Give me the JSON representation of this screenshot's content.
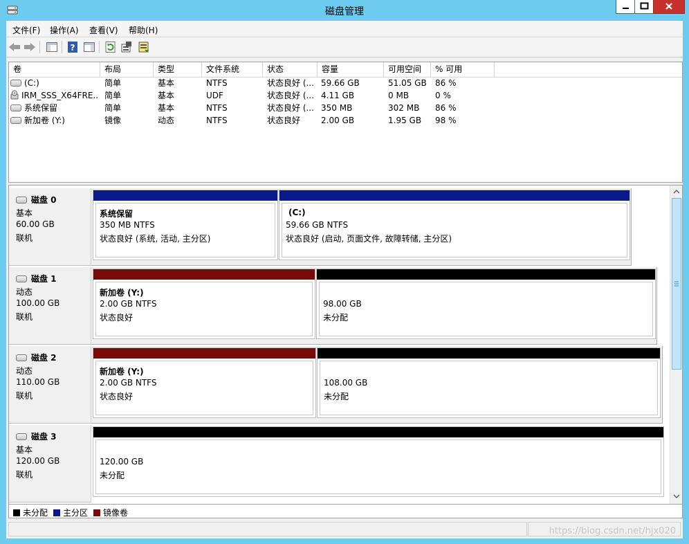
{
  "window": {
    "title": "磁盘管理"
  },
  "menubar": {
    "items": [
      "文件(F)",
      "操作(A)",
      "查看(V)",
      "帮助(H)"
    ]
  },
  "toolbar": {
    "buttons": [
      "back-icon",
      "forward-icon",
      "show-hide-tree-icon",
      "help-icon",
      "console-view-icon",
      "refresh-icon",
      "properties-icon",
      "export-icon"
    ]
  },
  "volume_list": {
    "columns": [
      "卷",
      "布局",
      "类型",
      "文件系统",
      "状态",
      "容量",
      "可用空间",
      "% 可用"
    ],
    "rows": [
      {
        "icon": "drive-icon",
        "volume": "(C:)",
        "layout": "简单",
        "type": "基本",
        "fs": "NTFS",
        "status": "状态良好 (...",
        "capacity": "59.66 GB",
        "free": "51.05 GB",
        "pct": "86 %"
      },
      {
        "icon": "cd-icon",
        "volume": "IRM_SSS_X64FRE...",
        "layout": "简单",
        "type": "基本",
        "fs": "UDF",
        "status": "状态良好 (...",
        "capacity": "4.11 GB",
        "free": "0 MB",
        "pct": "0 %"
      },
      {
        "icon": "drive-icon",
        "volume": "系统保留",
        "layout": "简单",
        "type": "基本",
        "fs": "NTFS",
        "status": "状态良好 (...",
        "capacity": "350 MB",
        "free": "302 MB",
        "pct": "86 %"
      },
      {
        "icon": "drive-icon",
        "volume": "新加卷 (Y:)",
        "layout": "镜像",
        "type": "动态",
        "fs": "NTFS",
        "status": "状态良好",
        "capacity": "2.00 GB",
        "free": "1.95 GB",
        "pct": "98 %"
      }
    ]
  },
  "disks": [
    {
      "name": "磁盘 0",
      "type": "基本",
      "size": "60.00 GB",
      "state": "联机",
      "partitions": [
        {
          "color": "#0a1a8c",
          "name": "系统保留",
          "line2": "350 MB NTFS",
          "line3": "状态良好 (系统, 活动, 主分区)"
        },
        {
          "color": "#0a1a8c",
          "name": "(C:)",
          "line2": "59.66 GB NTFS",
          "line3": "状态良好 (启动, 页面文件, 故障转储, 主分区)"
        }
      ]
    },
    {
      "name": "磁盘 1",
      "type": "动态",
      "size": "100.00 GB",
      "state": "联机",
      "partitions": [
        {
          "color": "#7a0a0a",
          "name": "新加卷 (Y:)",
          "line2": "2.00 GB NTFS",
          "line3": "状态良好"
        },
        {
          "color": "#000000",
          "name": "",
          "line2": "98.00 GB",
          "line3": "未分配"
        }
      ]
    },
    {
      "name": "磁盘 2",
      "type": "动态",
      "size": "110.00 GB",
      "state": "联机",
      "partitions": [
        {
          "color": "#7a0a0a",
          "name": "新加卷 (Y:)",
          "line2": "2.00 GB NTFS",
          "line3": "状态良好"
        },
        {
          "color": "#000000",
          "name": "",
          "line2": "108.00 GB",
          "line3": "未分配"
        }
      ]
    },
    {
      "name": "磁盘 3",
      "type": "基本",
      "size": "120.00 GB",
      "state": "联机",
      "partitions": [
        {
          "color": "#000000",
          "name": "",
          "line2": "120.00 GB",
          "line3": "未分配"
        }
      ]
    }
  ],
  "legend": [
    {
      "color": "#000000",
      "label": "未分配"
    },
    {
      "color": "#0a1a8c",
      "label": "主分区"
    },
    {
      "color": "#7a0a0a",
      "label": "镜像卷"
    }
  ],
  "watermark": "https://blog.csdn.net/hjx020"
}
